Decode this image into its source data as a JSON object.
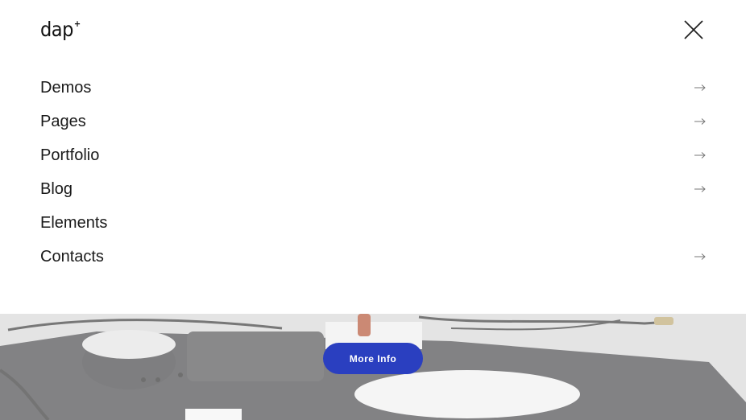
{
  "header": {
    "logo_text": "dap",
    "logo_sup": "+",
    "close_icon": "close-icon"
  },
  "menu": {
    "items": [
      {
        "label": "Demos",
        "has_arrow": true
      },
      {
        "label": "Pages",
        "has_arrow": true
      },
      {
        "label": "Portfolio",
        "has_arrow": true
      },
      {
        "label": "Blog",
        "has_arrow": true
      },
      {
        "label": "Elements",
        "has_arrow": false
      },
      {
        "label": "Contacts",
        "has_arrow": true
      }
    ],
    "arrow_icon": "arrow-right-icon"
  },
  "hero": {
    "button_label": "More Info",
    "button_color": "#2a3fc0"
  }
}
